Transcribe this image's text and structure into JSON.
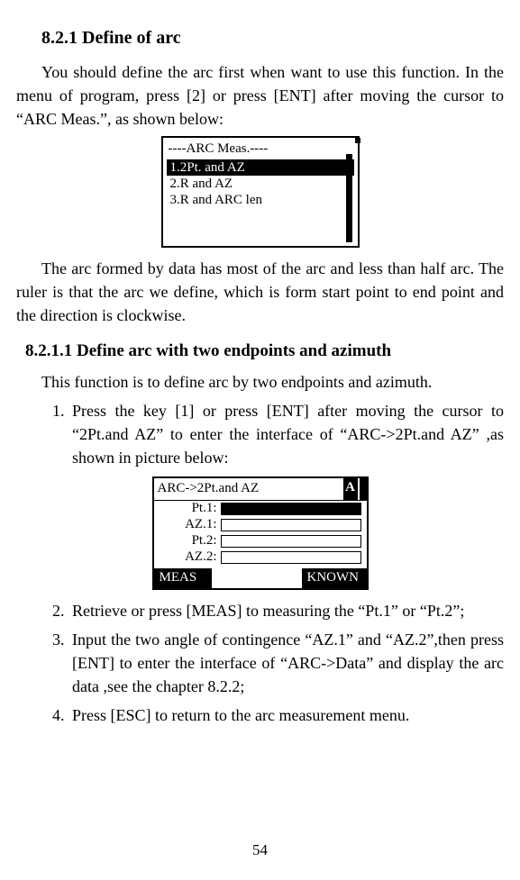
{
  "page_number": "54",
  "headings": {
    "h3": "8.2.1 Define of arc",
    "h4": "8.2.1.1 Define arc with two endpoints and azimuth"
  },
  "paragraphs": {
    "p1": "You should define the arc first when want to use this function. In the menu of program, press [2] or press [ENT] after moving the cursor to “ARC Meas.”, as shown below:",
    "p2": "The arc formed by data has most of the arc and less than half arc. The ruler is that the arc we define, which is form start point to end point and the direction is clockwise.",
    "p3": "This function is to define arc by two endpoints and azimuth."
  },
  "list": {
    "li1": "Press the key [1] or press [ENT] after moving the cursor to “2Pt.and AZ” to enter the interface of “ARC->2Pt.and AZ” ,as shown in picture below:",
    "li2": "Retrieve or press [MEAS] to measuring the “Pt.1” or “Pt.2”;",
    "li3": "Input the two angle of contingence “AZ.1” and “AZ.2”,then press [ENT] to enter the interface of “ARC->Data” and display the arc data ,see the chapter 8.2.2;",
    "li4": "Press [ESC] to return to the arc measurement menu."
  },
  "screen1": {
    "title": "----ARC Meas.----",
    "items": {
      "i1": "1.2Pt. and AZ",
      "i2": "2.R and AZ",
      "i3": "3.R and ARC len"
    }
  },
  "screen2": {
    "title": "ARC->2Pt.and AZ",
    "badge": "A",
    "rows": {
      "r1": "Pt.1:",
      "r2": "AZ.1:",
      "r3": "Pt.2:",
      "r4": "AZ.2:"
    },
    "soft": {
      "left": "MEAS",
      "right": "KNOWN"
    }
  }
}
